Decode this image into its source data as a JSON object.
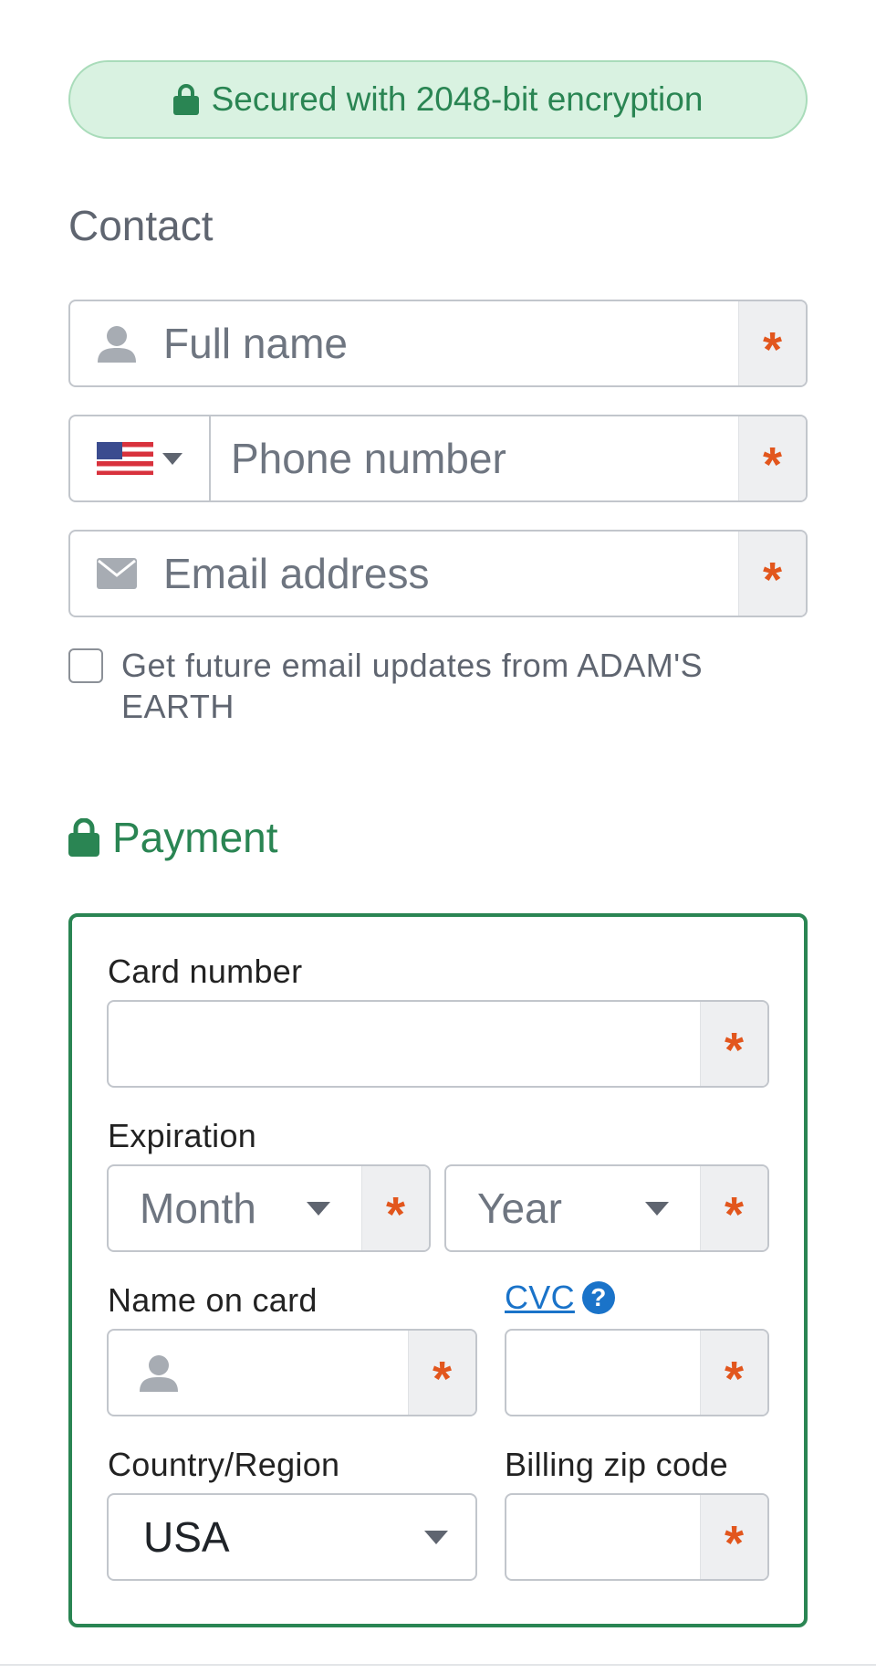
{
  "banner": {
    "text": "Secured with 2048-bit encryption",
    "icon": "lock-icon"
  },
  "contact": {
    "title": "Contact",
    "full_name": {
      "placeholder": "Full name",
      "icon": "person-icon",
      "required_mark": "*"
    },
    "phone": {
      "placeholder": "Phone number",
      "country_flag": "us-flag-icon",
      "required_mark": "*"
    },
    "email": {
      "placeholder": "Email address",
      "icon": "envelope-icon",
      "required_mark": "*"
    },
    "updates_checkbox": {
      "label": "Get future email updates from ADAM'S EARTH",
      "checked": false
    }
  },
  "payment": {
    "title": "Payment",
    "card_number": {
      "label": "Card number",
      "value": "",
      "required_mark": "*"
    },
    "expiration": {
      "label": "Expiration",
      "month": {
        "value": "Month",
        "required_mark": "*"
      },
      "year": {
        "value": "Year",
        "required_mark": "*"
      }
    },
    "name_on_card": {
      "label": "Name on card",
      "icon": "person-icon",
      "required_mark": "*"
    },
    "cvc": {
      "label": "CVC",
      "help": "?",
      "required_mark": "*"
    },
    "country": {
      "label": "Country/Region",
      "value": "USA"
    },
    "billing_zip": {
      "label": "Billing zip code",
      "required_mark": "*"
    }
  },
  "colors": {
    "accent_green": "#2a8553",
    "banner_bg": "#d9f2e1",
    "required_orange": "#e2561d",
    "link_blue": "#1a73c9"
  }
}
